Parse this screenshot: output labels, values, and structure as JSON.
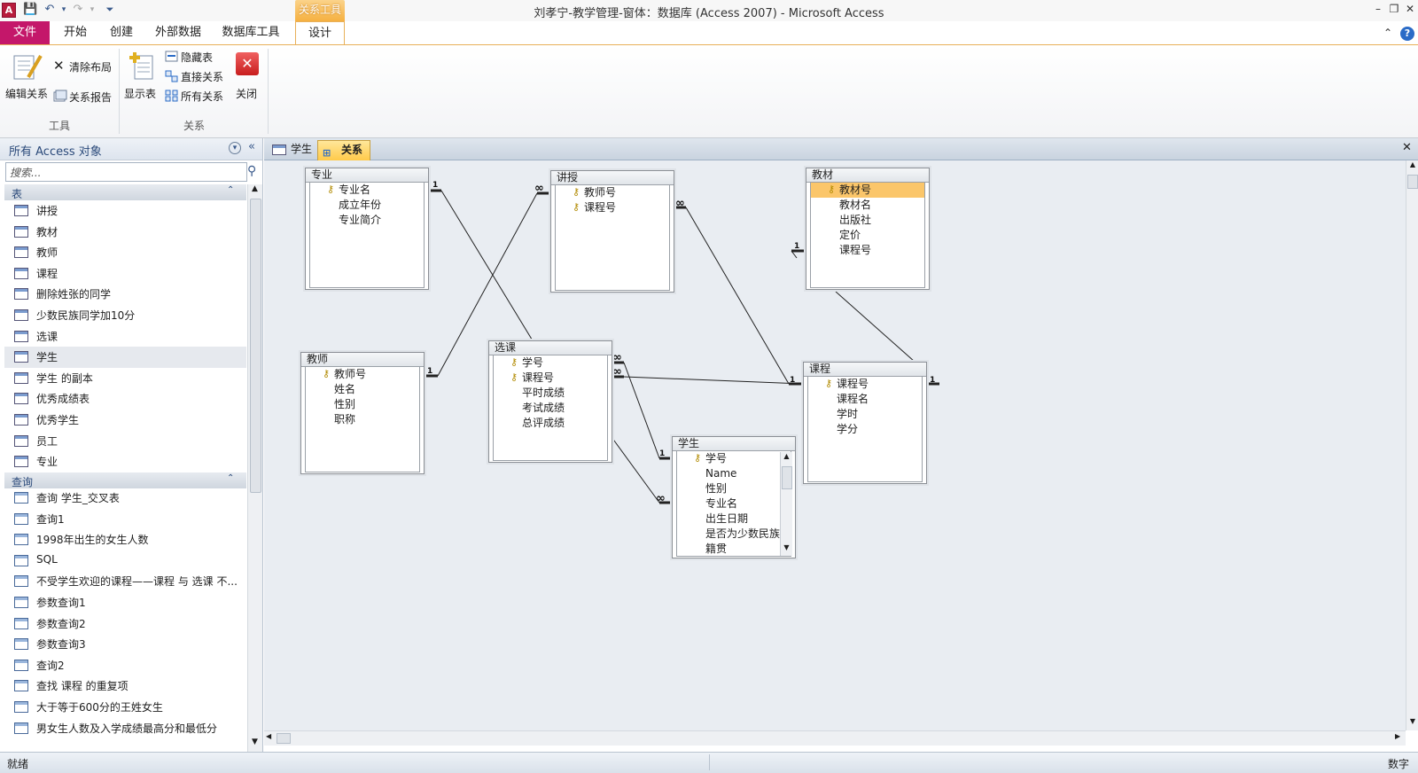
{
  "window": {
    "title": "刘孝宁-教学管理-窗体：数据库 (Access 2007)  -  Microsoft Access",
    "app_icon": "A"
  },
  "ribbon": {
    "contextual_tab": "关系工具",
    "tabs": [
      "文件",
      "开始",
      "创建",
      "外部数据",
      "数据库工具",
      "设计"
    ],
    "active_tab": "设计",
    "groups": {
      "tools": {
        "label": "工具",
        "edit_relationships": "编辑关系",
        "clear_layout": "清除布局",
        "relationship_report": "关系报告"
      },
      "relationships": {
        "label": "关系",
        "show_table": "显示表",
        "hide_table": "隐藏表",
        "direct_relationships": "直接关系",
        "all_relationships": "所有关系",
        "close": "关闭"
      }
    }
  },
  "nav": {
    "title": "所有 Access 对象",
    "search_placeholder": "搜索...",
    "tables_header": "表",
    "tables": [
      "讲授",
      "教材",
      "教师",
      "课程",
      "删除姓张的同学",
      "少数民族同学加10分",
      "选课",
      "学生",
      "学生 的副本",
      "优秀成绩表",
      "优秀学生",
      "员工",
      "专业"
    ],
    "selected_table": "学生",
    "queries_header": "查询",
    "queries": [
      "查询 学生_交叉表",
      "查询1",
      "1998年出生的女生人数",
      "SQL",
      "不受学生欢迎的课程——课程 与 选课 不...",
      "参数查询1",
      "参数查询2",
      "参数查询3",
      "查询2",
      "查找 课程 的重复项",
      "大于等于600分的王姓女生",
      "男女生人数及入学成绩最高分和最低分"
    ]
  },
  "doc_tabs": [
    "学生",
    "关系"
  ],
  "active_doc_tab": "关系",
  "diagram": {
    "tables": {
      "zhuanye": {
        "name": "专业",
        "fields": [
          "专业名",
          "成立年份",
          "专业简介"
        ],
        "keys": [
          "专业名"
        ]
      },
      "jiangshou": {
        "name": "讲授",
        "fields": [
          "教师号",
          "课程号"
        ],
        "keys": [
          "教师号",
          "课程号"
        ]
      },
      "jiaocai": {
        "name": "教材",
        "fields": [
          "教材号",
          "教材名",
          "出版社",
          "定价",
          "课程号"
        ],
        "keys": [
          "教材号"
        ],
        "highlighted": "教材号"
      },
      "jiaoshi": {
        "name": "教师",
        "fields": [
          "教师号",
          "姓名",
          "性别",
          "职称"
        ],
        "keys": [
          "教师号"
        ]
      },
      "xuanke": {
        "name": "选课",
        "fields": [
          "学号",
          "课程号",
          "平时成绩",
          "考试成绩",
          "总评成绩"
        ],
        "keys": [
          "学号",
          "课程号"
        ]
      },
      "kecheng": {
        "name": "课程",
        "fields": [
          "课程号",
          "课程名",
          "学时",
          "学分"
        ],
        "keys": [
          "课程号"
        ]
      },
      "xuesheng": {
        "name": "学生",
        "fields": [
          "学号",
          "Name",
          "性别",
          "专业名",
          "出生日期",
          "是否为少数民族",
          "籍贯"
        ],
        "keys": [
          "学号"
        ]
      }
    },
    "one_marker": "1",
    "many_marker": "∞"
  },
  "status": {
    "left": "就绪",
    "right": "数字"
  },
  "colors": {
    "file_tab": "#c4176a",
    "contextual": "#f5b040",
    "highlight_field": "#fbc66a",
    "canvas": "#e9edf2"
  }
}
